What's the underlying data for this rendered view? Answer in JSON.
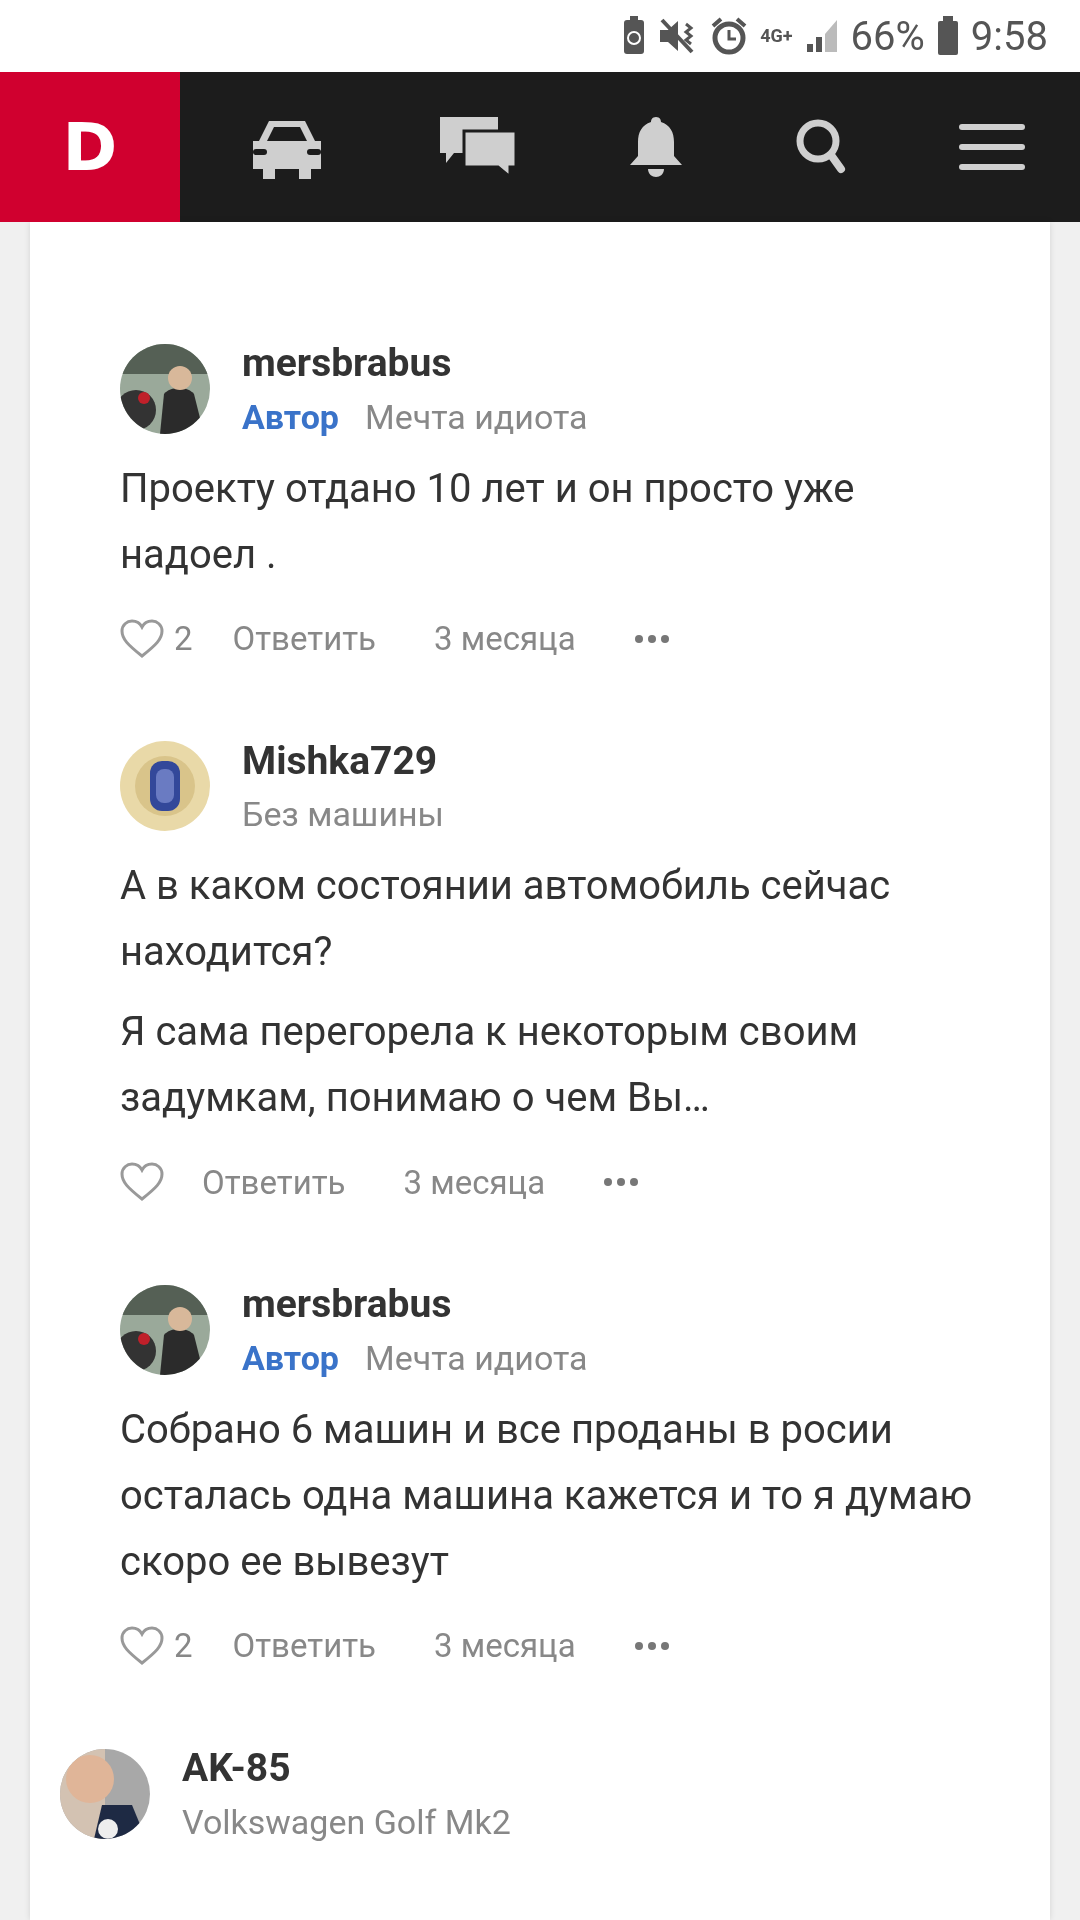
{
  "status_bar": {
    "network": "4G+",
    "battery": "66%",
    "time": "9:58"
  },
  "nav": {
    "logo": "D"
  },
  "comments": [
    {
      "kind": "reply",
      "author": "mersbrabus",
      "badge": "Автор",
      "car": "Мечта идиота",
      "paragraphs": [
        "Проекту отдано 10 лет и он просто уже надоел ."
      ],
      "likes": "2",
      "reply": "Ответить",
      "time": "3 месяца"
    },
    {
      "kind": "reply",
      "author": "Mishka729",
      "car": "Без машины",
      "paragraphs": [
        "А в каком состоянии автомобиль сейчас находится?",
        "Я сама перегорела к некоторым своим задумкам, понимаю о чем Вы…"
      ],
      "reply": "Ответить",
      "time": "3 месяца"
    },
    {
      "kind": "reply",
      "author": "mersbrabus",
      "badge": "Автор",
      "car": "Мечта идиота",
      "paragraphs": [
        "Собрано 6 машин и все проданы в росии осталась одна машина кажется и то я думаю скоро ее вывезут"
      ],
      "likes": "2",
      "reply": "Ответить",
      "time": "3 месяца"
    },
    {
      "kind": "top",
      "author": "AK-85",
      "car": "Volkswagen Golf Mk2"
    }
  ]
}
